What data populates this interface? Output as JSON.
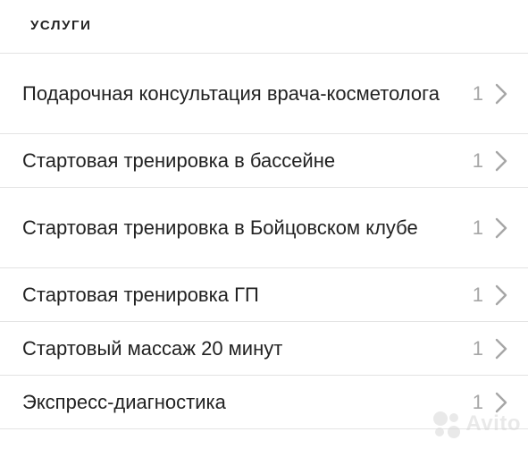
{
  "section": {
    "title": "УСЛУГИ"
  },
  "items": [
    {
      "label": "Подарочная консультация врача-косметолога",
      "count": "1"
    },
    {
      "label": "Стартовая тренировка в бассейне",
      "count": "1"
    },
    {
      "label": "Стартовая тренировка в Бойцовском клубе",
      "count": "1"
    },
    {
      "label": "Стартовая тренировка ГП",
      "count": "1"
    },
    {
      "label": "Стартовый массаж 20 минут",
      "count": "1"
    },
    {
      "label": "Экспресс-диагностика",
      "count": "1"
    }
  ],
  "watermark": {
    "text": "Avito"
  },
  "icons": {
    "row_chevron": "chevron-right-icon",
    "watermark_logo": "avito-logo-icon"
  },
  "colors": {
    "text": "#222222",
    "count": "#a6a6a6",
    "divider": "#e3e3e3",
    "background": "#ffffff"
  }
}
